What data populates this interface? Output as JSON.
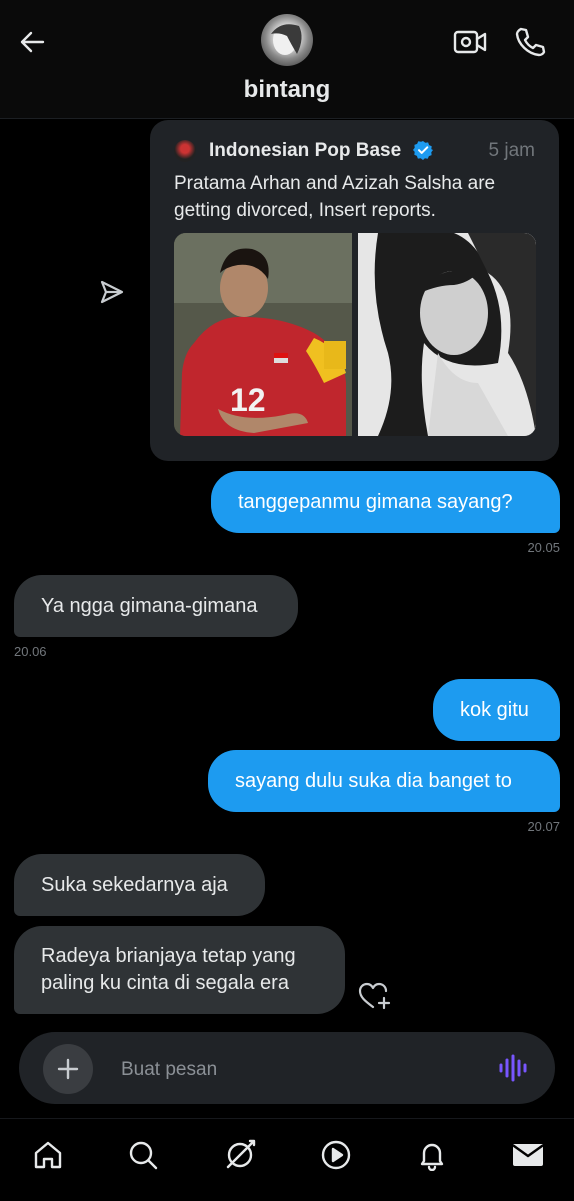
{
  "header": {
    "contact_name": "bintang"
  },
  "shared_post": {
    "source": "Indonesian Pop Base",
    "time": "5 jam",
    "text": "Pratama Arhan and Azizah Salsha are getting divorced, Insert reports.",
    "jersey_number": "12"
  },
  "messages": [
    {
      "direction": "out",
      "text": "tanggepanmu gimana sayang?",
      "time": "20.05"
    },
    {
      "direction": "in",
      "text": "Ya ngga gimana-gimana",
      "time": "20.06"
    },
    {
      "direction": "out",
      "text": "kok gitu",
      "time": ""
    },
    {
      "direction": "out",
      "text": "sayang dulu suka dia banget to",
      "time": "20.07"
    },
    {
      "direction": "in",
      "text": "Suka sekedarnya aja",
      "time": ""
    },
    {
      "direction": "in",
      "text": "Radeya brianjaya tetap yang paling ku cinta di segala era",
      "time": ""
    }
  ],
  "composer": {
    "placeholder": "Buat pesan"
  },
  "colors": {
    "outgoing_bubble": "#1d9bf0",
    "incoming_bubble": "#2f3336",
    "verified_badge": "#1d9bf0",
    "voice_icon": "#7856ff"
  },
  "icons": {
    "back": "arrow-left-icon",
    "video_call": "video-camera-icon",
    "voice_call": "phone-icon",
    "share": "paper-plane-icon",
    "react": "heart-plus-icon",
    "add": "plus-icon",
    "voice": "waveform-icon",
    "nav": [
      "home-icon",
      "search-icon",
      "grok-icon",
      "play-icon",
      "bell-icon",
      "mail-icon"
    ]
  }
}
